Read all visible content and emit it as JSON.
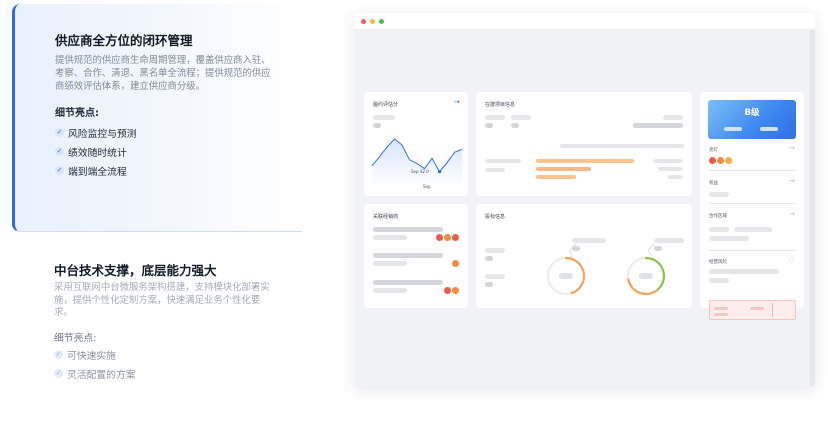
{
  "feature1": {
    "title": "供应商全方位的闭环管理",
    "description": "提供规范的供应商生命周期管理，覆盖供应商入驻、考察、合作、清退、黑名单全流程；提供规范的供应商绩效评估体系，建立供应商分级。",
    "highlights_title": "细节亮点:",
    "highlights": [
      "风险监控与预测",
      "绩效随时统计",
      "端到端全流程"
    ]
  },
  "feature2": {
    "title": "中台技术支撑，底层能力强大",
    "description": "采用互联网中台微服务架构搭建，支持模块化部署实施，提供个性化定制方案，快速满足业务个性化要求。",
    "highlights_title": "细节亮点:",
    "highlights": [
      "可快速实施",
      "灵活配置的方案"
    ]
  },
  "dashboard": {
    "perf_title": "履约评估分",
    "perf_tooltip": "Sep  42.0",
    "perf_axis": "Sep",
    "perf_chart_values": [
      30,
      42,
      55,
      66,
      58,
      38,
      33,
      26,
      40,
      22,
      34,
      48,
      52
    ],
    "project_title": "在建项目信息",
    "related_title": "关联经销商",
    "bid_title": "投标信息",
    "grade": "B级",
    "lights_label": "亮灯",
    "equity_label": "权益",
    "coop_label": "合作区域",
    "risk_label": "经营风险",
    "gauge1_percent": 0.45,
    "gauge2_percent": 0.72,
    "colors": {
      "accent": "#2f6fe6",
      "orange": "#f6a45a",
      "red": "#ef5b4a",
      "green": "#8bc34a"
    }
  }
}
